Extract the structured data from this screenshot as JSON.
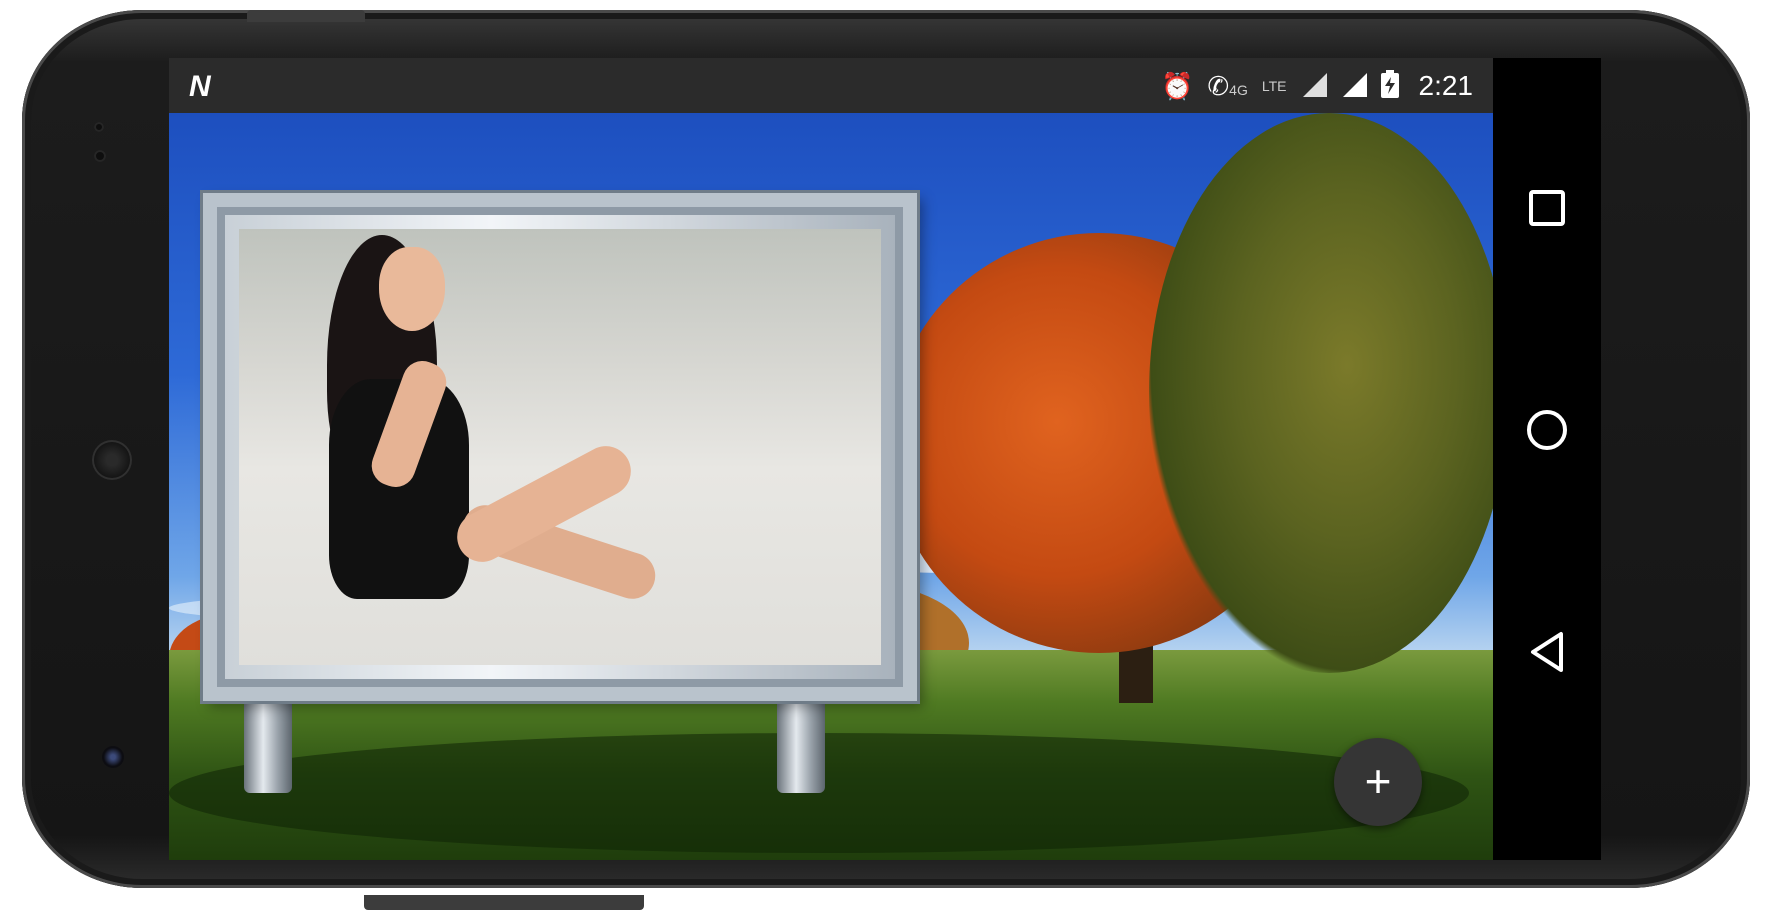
{
  "status_bar": {
    "notification_icon": "n-logo-icon",
    "icons": [
      "alarm-icon",
      "wifi-call-icon",
      "signal-icon",
      "signal-icon",
      "battery-charging-icon"
    ],
    "network_label": "4G",
    "network_label_2": "LTE",
    "time": "2:21"
  },
  "app": {
    "frame_style": "billboard",
    "fab_label": "+"
  },
  "nav_bar": {
    "recents": "recents-icon",
    "home": "home-icon",
    "back": "back-icon"
  },
  "colors": {
    "status_bar": "#2b2b2b",
    "fab": "#353535",
    "nav_bar": "#000000",
    "sky": "#1d4fbf"
  }
}
